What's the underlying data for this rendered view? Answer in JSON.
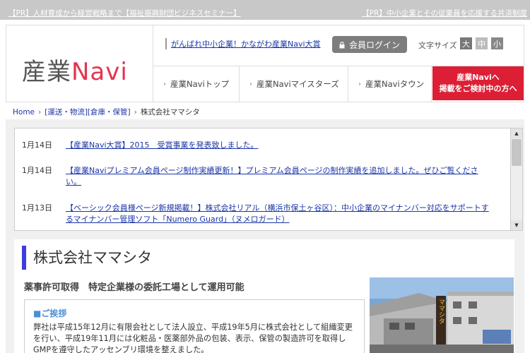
{
  "pr_bar": {
    "left": "【PR】人材育成から経営戦略まで【福祉振興財団ビジネスセミナー】",
    "right": "【PR】中小企業とその従業員を応援する共済制度"
  },
  "header": {
    "logo_kanji": "産業",
    "logo_navi": "Navi",
    "promo_link": "がんばれ中小企業！かながわ産業Navi大賞",
    "login_label": "会員ログイン",
    "font_size_label": "文字サイズ",
    "font_size_large": "大",
    "font_size_medium": "中",
    "font_size_small": "小",
    "nav": [
      {
        "label": "産業Naviトップ"
      },
      {
        "label": "産業Naviマイスターズ"
      },
      {
        "label": "産業Naviタウン"
      }
    ],
    "cta_line1": "産業Naviへ",
    "cta_line2": "掲載をご検討中の方へ"
  },
  "breadcrumb": {
    "home": "Home",
    "category": "[運送・物流][倉庫・保管]",
    "current": "株式会社ママシタ"
  },
  "news": [
    {
      "date": "1月14日",
      "text": "【産業Navi大賞】2015　受賞事業を発表致しました。"
    },
    {
      "date": "1月14日",
      "text": "【産業Naviプレミアム会員ページ制作実績更新！】プレミアム会員ページの制作実績を追加しました。ぜひご覧ください。"
    },
    {
      "date": "1月13日",
      "text": "【ベーシック会員様ページ新規掲載！】株式会社リアル（横浜市保土ヶ谷区）：中小企業のマイナンバー対応をサポートするマイナンバー管理ソフト「Numero Guard」（ヌメロガード）"
    }
  ],
  "company": {
    "name": "株式会社ママシタ",
    "subtitle": "薬事許可取得　特定企業様の委託工場として運用可能",
    "greeting_heading": "■ご挨拶",
    "greeting_text": "弊社は平成15年12月に有限会社として法人設立、平成19年5月に株式会社として組織変更を行い、平成19年11月には化粧品・医薬部外品の包装、表示、保管の製造許可を取得しGMPを遵守したアッセンブリ環境を整えました。",
    "photo_sign": "ママシタ"
  },
  "colors": {
    "brand_red": "#dc1f35",
    "title_accent": "#3d3ce0",
    "link_blue": "#1a35a8"
  }
}
